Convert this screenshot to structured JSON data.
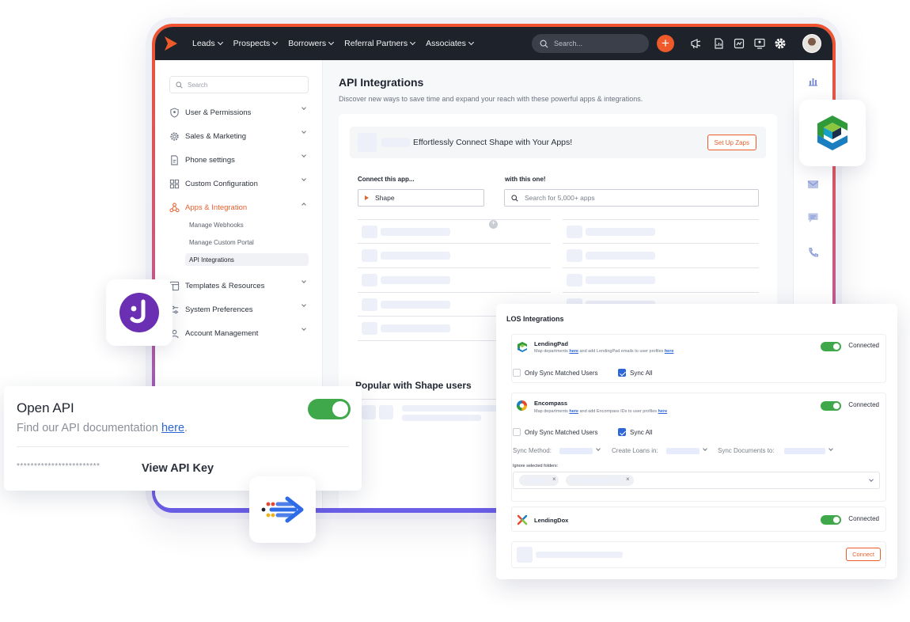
{
  "topbar": {
    "nav": [
      "Leads",
      "Prospects",
      "Borrowers",
      "Referral Partners",
      "Associates"
    ],
    "search_placeholder": "Search...",
    "plus_label": "+"
  },
  "sidebar": {
    "search_placeholder": "Search",
    "items": [
      {
        "label": "User & Permissions",
        "icon": "shield-user-icon"
      },
      {
        "label": "Sales & Marketing",
        "icon": "gear-icon"
      },
      {
        "label": "Phone settings",
        "icon": "phone-doc-icon"
      },
      {
        "label": "Custom Configuration",
        "icon": "grid-icon"
      },
      {
        "label": "Apps & Integration",
        "icon": "share-nodes-icon",
        "active": true
      },
      {
        "label": "Templates & Resources",
        "icon": "template-icon"
      },
      {
        "label": "System Preferences",
        "icon": "sliders-icon"
      },
      {
        "label": "Account Management",
        "icon": "account-icon"
      }
    ],
    "subitems": [
      "Manage Webhooks",
      "Manage Custom Portal",
      "API Integrations"
    ],
    "selected_sub": "API Integrations"
  },
  "main": {
    "title": "API Integrations",
    "subtitle": "Discover new ways to save time and expand your reach with these powerful apps & integrations.",
    "zap_text": "Effortlessly Connect Shape with Your Apps!",
    "zap_button": "Set Up Zaps",
    "connect_label": "Connect this app...",
    "with_label": "with this one!",
    "app_value": "Shape",
    "app_search_placeholder": "Search for 5,000+ apps",
    "popular_title": "Popular with Shape users"
  },
  "open_api": {
    "title": "Open API",
    "desc_prefix": "Find our API documentation ",
    "desc_link": "here",
    "desc_suffix": ".",
    "toggle_on": true,
    "masked_key": "************************",
    "view_key": "View API Key"
  },
  "los": {
    "title": "LOS Integrations",
    "integrations": [
      {
        "name": "LendingPad",
        "desc_a": "Map departments ",
        "link1": "here",
        "desc_b": " and add LendingPad emails to user profiles ",
        "link2": "here",
        "status": "Connected"
      },
      {
        "name": "Encompass",
        "desc_a": "Map departments ",
        "link1": "here",
        "desc_b": " and add Encompass IDs to user profiles ",
        "link2": "here",
        "status": "Connected"
      },
      {
        "name": "LendingDox",
        "status": "Connected"
      }
    ],
    "only_sync": "Only Sync Matched Users",
    "sync_all": "Sync All",
    "sync_method": "Sync Method:",
    "create_loans": "Create Loans in:",
    "sync_docs": "Sync Documents to:",
    "ignore_folders": "Ignore selected folders:",
    "chip_x": "×",
    "connect_button": "Connect"
  },
  "colors": {
    "accent": "#ee5a2a",
    "topbar": "#1e222b",
    "toggle_green": "#3ea84a",
    "link_blue": "#2d66d9"
  }
}
